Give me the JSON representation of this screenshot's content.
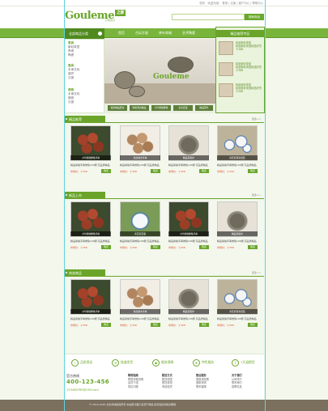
{
  "topbar": {
    "links": "您好，欢迎光临！ 登录 | 注册 | 客户中心 | 帮助中心"
  },
  "header": {
    "logo": "Gouleme",
    "logo_badge": "之家",
    "logo_sub": "高端茶具",
    "search_placeholder": "",
    "search_button": "搜索商品"
  },
  "nav": {
    "category": "全部商品分类",
    "items": [
      "首页",
      "古玩字画",
      "茶叶商城",
      "艺术陶瓷",
      "文房用品",
      "香道用品",
      "品牌专区"
    ]
  },
  "sidebar": {
    "groups": [
      {
        "title": "茶具",
        "items": [
          "紫砂茶壶",
          "青瓷",
          "陶瓷",
          "茶盘",
          "汝窑茶具"
        ]
      },
      {
        "title": "香具",
        "items": [
          "手串文玩",
          "香炉",
          "沉香",
          "香道",
          "文房雅器"
        ]
      },
      {
        "title": "佛珠",
        "items": [
          "手串文玩",
          "佛珠",
          "沉香",
          "手链",
          "文房雅器"
        ]
      }
    ]
  },
  "hero": {
    "logo": "Gouleme",
    "thumbs": [
      "紫砂精品茶具",
      "陶瓷茶具精品",
      "小叶紫檀佛珠",
      "文房四宝",
      "精品茶叶"
    ]
  },
  "recommend": {
    "title": "精品推荐专区",
    "items": [
      {
        "name": "精品紫砂茶壶",
        "desc": "精选紫砂茶壶精品好货 ￥388"
      },
      {
        "name": "精品紫砂茶壶",
        "desc": "精选紫砂茶壶精品好货 ￥388"
      },
      {
        "name": "精品紫砂茶壶",
        "desc": "精选紫砂茶壶精品好货 ￥388"
      }
    ]
  },
  "sections": [
    {
      "title": "精品推荐",
      "more": "更多>>",
      "cards": [
        {
          "caption": "小叶紫檀佛珠手串",
          "name": "精品紫檀手串佛珠108颗 高品质精品",
          "price": "市场价：￥358",
          "buy": "购买"
        },
        {
          "caption": "金丝楠木手串",
          "name": "精品紫檀手串佛珠108颗 高品质精品",
          "price": "市场价：￥358",
          "buy": "购买"
        },
        {
          "caption": "精品铜香炉",
          "name": "精品紫檀手串佛珠108颗 高品质精品",
          "price": "市场价：￥358",
          "buy": "购买"
        },
        {
          "caption": "青花瓷茶具套装",
          "name": "精品紫檀手串佛珠108颗 高品质精品",
          "price": "市场价：￥358",
          "buy": "购买"
        }
      ]
    },
    {
      "title": "新品上市",
      "more": "更多>>",
      "cards": [
        {
          "caption": "小叶紫檀佛珠手串",
          "name": "精品紫檀手串佛珠108颗 高品质精品",
          "price": "市场价：￥358",
          "buy": "购买"
        },
        {
          "caption": "青花瓷花瓶",
          "name": "精品紫檀手串佛珠108颗 高品质精品",
          "price": "市场价：￥358",
          "buy": "购买"
        },
        {
          "caption": "小叶紫檀佛珠手串",
          "name": "精品紫檀手串佛珠108颗 高品质精品",
          "price": "市场价：￥358",
          "buy": "购买"
        },
        {
          "caption": "精品铜香炉",
          "name": "精品紫檀手串佛珠108颗 高品质精品",
          "price": "市场价：￥358",
          "buy": "购买"
        }
      ]
    },
    {
      "title": "热卖商品",
      "more": "更多>>",
      "cards": [
        {
          "caption": "小叶紫檀佛珠手串",
          "name": "精品紫檀手串佛珠108颗 高品质精品",
          "price": "市场价：￥358",
          "buy": "购买"
        },
        {
          "caption": "金丝楠木手串",
          "name": "精品紫檀手串佛珠108颗 高品质精品",
          "price": "市场价：￥358",
          "buy": "购买"
        },
        {
          "caption": "精品铜香炉",
          "name": "精品紫檀手串佛珠108颗 高品质精品",
          "price": "市场价：￥358",
          "buy": "购买"
        },
        {
          "caption": "青花瓷茶具套装",
          "name": "精品紫檀手串佛珠108颗 高品质精品",
          "price": "市场价：￥358",
          "buy": "购买"
        }
      ]
    }
  ],
  "services": [
    "品质保证",
    "极速发货",
    "服务保障",
    "特色服务",
    "7天退换货"
  ],
  "footer": {
    "hotline_label": "官方热线",
    "phone": "400-123-456",
    "email": "123456789@163.com",
    "cols": [
      {
        "title": "购物指南",
        "items": [
          "购物流程说明",
          "会员介绍",
          "常见问题"
        ]
      },
      {
        "title": "配送方式",
        "items": [
          "配送范围",
          "配送费用",
          "商品验货"
        ]
      },
      {
        "title": "售后服务",
        "items": [
          "退换货政策",
          "退款说明",
          "联系客服"
        ]
      },
      {
        "title": "关于我们",
        "items": [
          "公司简介",
          "联系我们",
          "招聘信息"
        ]
      }
    ],
    "copyright": "© 2014-2016 文化商城版权所有 本站部分图片来源于网络 如有侵权请联系删除"
  }
}
